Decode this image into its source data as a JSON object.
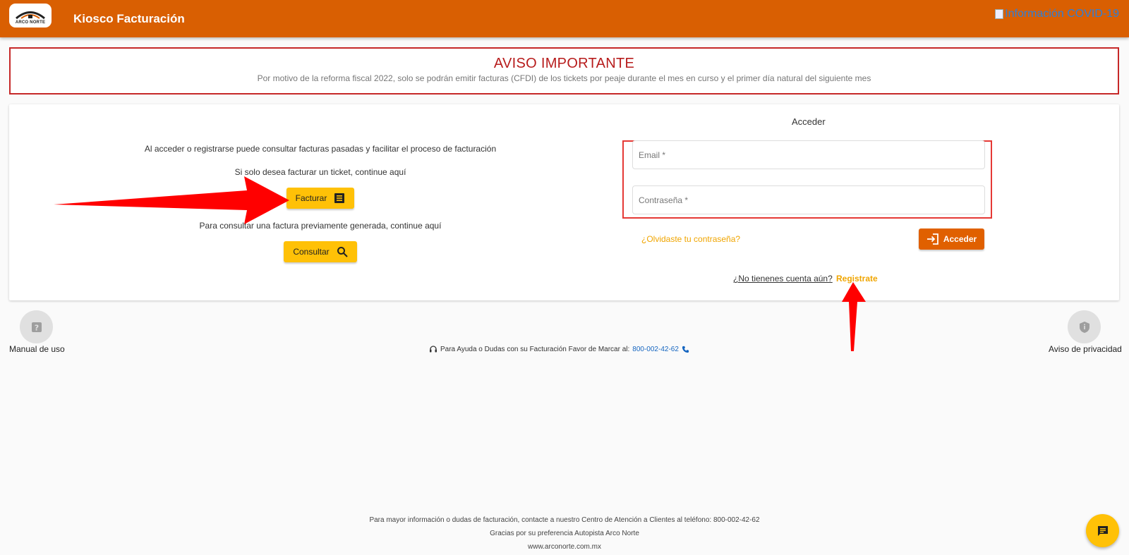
{
  "header": {
    "logo_text": "ARCO NORTE",
    "title": "Kiosco Facturación",
    "covid_link": "Información COVID-19"
  },
  "notice": {
    "title": "AVISO IMPORTANTE",
    "body": "Por motivo de la reforma fiscal 2022, solo se podrán emitir facturas (CFDI) de los tickets por peaje durante el mes en curso y el primer día natural del siguiente mes"
  },
  "left": {
    "intro": "Al acceder o registrarse puede consultar facturas pasadas y facilitar el proceso de facturación",
    "ticket_text": "Si solo desea facturar un ticket, continue aquí",
    "facturar_label": "Facturar",
    "consult_text": "Para consultar una factura previamente generada, continue aquí",
    "consultar_label": "Consultar"
  },
  "login": {
    "title": "Acceder",
    "email_placeholder": "Email *",
    "password_placeholder": "Contraseña *",
    "forgot_label": "¿Olvidaste tu contraseña?",
    "acceder_label": "Acceder",
    "no_account_label": "¿No tienenes cuenta aún?",
    "register_label": "Registrate"
  },
  "links": {
    "manual_label": "Manual de uso",
    "privacy_label": "Aviso de privacidad",
    "help_text": "Para Ayuda o Dudas con su Facturación Favor de Marcar al:",
    "help_phone": "800-002-42-62"
  },
  "footer": {
    "line1": "Para mayor información o dudas de facturación, contacte a nuestro Centro de Atención a Clientes al teléfono: 800-002-42-62",
    "line2": "Gracias por su preferencia Autopista Arco Norte",
    "line3": "www.arconorte.com.mx"
  },
  "colors": {
    "header": "#d95f02",
    "accent_yellow": "#ffc107",
    "notice_red": "#c62828",
    "acceder_orange": "#e06000"
  }
}
